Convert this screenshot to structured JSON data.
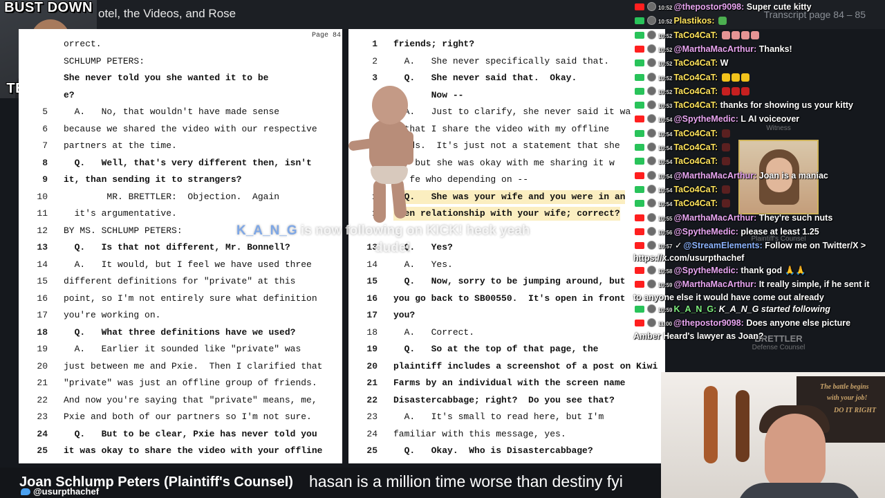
{
  "header": {
    "title": "otel, the Videos, and Rose",
    "transcript_pages": "Transcript page 84 – 85"
  },
  "logo": {
    "top": "BUST DOWN",
    "bottom": "TESTIMONY"
  },
  "left_page": {
    "label": "Page 84",
    "lines": [
      {
        "n": "",
        "t": "orrect.",
        "bold": false
      },
      {
        "n": "",
        "t": "SCHLUMP PETERS:",
        "bold": false
      },
      {
        "n": "",
        "t": "She never told you she wanted it to be",
        "bold": true
      },
      {
        "n": "",
        "t": "e?",
        "bold": true
      },
      {
        "n": "5",
        "t": "  A.   No, that wouldn't have made sense",
        "bold": false
      },
      {
        "n": "6",
        "t": "because we shared the video with our respective",
        "bold": false
      },
      {
        "n": "7",
        "t": "partners at the time.",
        "bold": false
      },
      {
        "n": "8",
        "t": "  Q.   Well, that's very different then, isn't",
        "bold": true
      },
      {
        "n": "9",
        "t": "it, than sending it to strangers?",
        "bold": true
      },
      {
        "n": "10",
        "t": "        MR. BRETTLER:  Objection.  Again",
        "bold": false
      },
      {
        "n": "11",
        "t": "  it's argumentative.",
        "bold": false
      },
      {
        "n": "12",
        "t": "BY MS. SCHLUMP PETERS:",
        "bold": false
      },
      {
        "n": "13",
        "t": "  Q.   Is that not different, Mr. Bonnell?",
        "bold": true
      },
      {
        "n": "14",
        "t": "  A.   It would, but I feel we have used three",
        "bold": false
      },
      {
        "n": "15",
        "t": "different definitions for \"private\" at this",
        "bold": false
      },
      {
        "n": "16",
        "t": "point, so I'm not entirely sure what definition",
        "bold": false
      },
      {
        "n": "17",
        "t": "you're working on.",
        "bold": false
      },
      {
        "n": "18",
        "t": "  Q.   What three definitions have we used?",
        "bold": true
      },
      {
        "n": "19",
        "t": "  A.   Earlier it sounded like \"private\" was",
        "bold": false
      },
      {
        "n": "20",
        "t": "just between me and Pxie.  Then I clarified that",
        "bold": false
      },
      {
        "n": "21",
        "t": "\"private\" was just an offline group of friends.",
        "bold": false
      },
      {
        "n": "22",
        "t": "And now you're saying that \"private\" means, me,",
        "bold": false
      },
      {
        "n": "23",
        "t": "Pxie and both of our partners so I'm not sure.",
        "bold": false
      },
      {
        "n": "24",
        "t": "  Q.   But to be clear, Pxie has never told you",
        "bold": true
      },
      {
        "n": "25",
        "t": "it was okay to share the video with your offline",
        "bold": true
      }
    ]
  },
  "right_page": {
    "lines": [
      {
        "n": "1",
        "t": "friends; right?",
        "bold": true,
        "hl": false
      },
      {
        "n": "2",
        "t": "  A.   She never specifically said that.",
        "bold": false,
        "hl": false
      },
      {
        "n": "3",
        "t": "  Q.   She never said that.  Okay.",
        "bold": true,
        "hl": false
      },
      {
        "n": "",
        "t": "       Now --",
        "bold": true,
        "hl": false
      },
      {
        "n": "",
        "t": "  A.   Just to clarify, she never said it wa",
        "bold": false,
        "hl": false
      },
      {
        "n": "",
        "t": "  that I share the video with my offline",
        "bold": false,
        "hl": false
      },
      {
        "n": "",
        "t": "  nds.  It's just not a statement that she",
        "bold": false,
        "hl": false
      },
      {
        "n": "",
        "t": "  , but she was okay with me sharing it w",
        "bold": false,
        "hl": false
      },
      {
        "n": "",
        "t": "   fe who depending on --",
        "bold": false,
        "hl": false
      },
      {
        "n": "1",
        "t": "  Q.   She was your wife and you were in an",
        "bold": true,
        "hl": true
      },
      {
        "n": "1",
        "t": "  en relationship with your wife; correct?",
        "bold": true,
        "hl": true
      },
      {
        "n": "",
        "t": "",
        "bold": false,
        "hl": false
      },
      {
        "n": "13",
        "t": "  Q.   Yes?",
        "bold": true,
        "hl": false
      },
      {
        "n": "14",
        "t": "  A.   Yes.",
        "bold": false,
        "hl": false
      },
      {
        "n": "15",
        "t": "  Q.   Now, sorry to be jumping around, but",
        "bold": true,
        "hl": false
      },
      {
        "n": "16",
        "t": "you go back to SB00550.  It's open in front",
        "bold": true,
        "hl": false
      },
      {
        "n": "17",
        "t": "you?",
        "bold": true,
        "hl": false
      },
      {
        "n": "18",
        "t": "  A.   Correct.",
        "bold": false,
        "hl": false
      },
      {
        "n": "19",
        "t": "  Q.   So at the top of that page, the",
        "bold": true,
        "hl": false
      },
      {
        "n": "20",
        "t": "plaintiff includes a screenshot of a post on Kiwi",
        "bold": true,
        "hl": false
      },
      {
        "n": "21",
        "t": "Farms by an individual with the screen name",
        "bold": true,
        "hl": false
      },
      {
        "n": "22",
        "t": "Disastercabbage; right?  Do you see that?",
        "bold": true,
        "hl": false
      },
      {
        "n": "23",
        "t": "  A.   It's small to read here, but I'm",
        "bold": false,
        "hl": false
      },
      {
        "n": "24",
        "t": "familiar with this message, yes.",
        "bold": false,
        "hl": false
      },
      {
        "n": "25",
        "t": "  Q.   Okay.  Who is Disastercabbage?",
        "bold": true,
        "hl": false
      }
    ]
  },
  "follow_alert": {
    "name": "K_A_N_G",
    "text": " is now following on KICK! heck yeah",
    "line2": "dude!"
  },
  "side_panels": {
    "witness_label": "Witness",
    "counsel_name": "BRETTLER",
    "counsel_role": "Defense Counsel",
    "plaintiff_counsel_role": "Plaintiff's Counsel"
  },
  "chat": [
    {
      "p": "yt",
      "time": "10:52",
      "user": "@thepostor9098:",
      "color": "#e9a6f2",
      "msg": "Super cute kitty"
    },
    {
      "p": "kk",
      "time": "10:52",
      "user": "Plastikos:",
      "color": "#ffe45c",
      "msg": "",
      "emoji": [
        "#4caf50"
      ]
    },
    {
      "p": "kk",
      "time": "10:52",
      "user": "TaCo4CaT:",
      "color": "#ffe45c",
      "msg": "",
      "emoji": [
        "#e59494",
        "#e59494",
        "#e59494",
        "#e59494"
      ]
    },
    {
      "p": "yt",
      "time": "10:52",
      "user": "@MarthaMacArthur:",
      "color": "#e9a6f2",
      "msg": "Thanks!"
    },
    {
      "p": "kk",
      "time": "10:52",
      "user": "TaCo4CaT:",
      "color": "#ffe45c",
      "msg": "W"
    },
    {
      "p": "kk",
      "time": "10:52",
      "user": "TaCo4CaT:",
      "color": "#ffe45c",
      "msg": "",
      "emoji": [
        "#f2c31b",
        "#f2c31b",
        "#f2c31b"
      ]
    },
    {
      "p": "kk",
      "time": "10:52",
      "user": "TaCo4CaT:",
      "color": "#ffe45c",
      "msg": "",
      "emoji": [
        "#c62020",
        "#c62020",
        "#c62020"
      ]
    },
    {
      "p": "kk",
      "time": "10:53",
      "user": "TaCo4CaT:",
      "color": "#ffe45c",
      "msg": "thanks for showing us your kitty"
    },
    {
      "p": "yt",
      "time": "10:54",
      "user": "@SpytheMedic:",
      "color": "#e9a6f2",
      "msg": "L AI voiceover"
    },
    {
      "p": "kk",
      "time": "10:54",
      "user": "TaCo4CaT:",
      "color": "#ffe45c",
      "msg": "",
      "emoji": [
        "#5a2020"
      ]
    },
    {
      "p": "kk",
      "time": "10:54",
      "user": "TaCo4CaT:",
      "color": "#ffe45c",
      "msg": "",
      "emoji": [
        "#5a2020"
      ]
    },
    {
      "p": "kk",
      "time": "10:54",
      "user": "TaCo4CaT:",
      "color": "#ffe45c",
      "msg": "",
      "emoji": [
        "#5a2020"
      ]
    },
    {
      "p": "yt",
      "time": "10:54",
      "user": "@MarthaMacArthur:",
      "color": "#e9a6f2",
      "msg": "Joan is a maniac"
    },
    {
      "p": "kk",
      "time": "10:54",
      "user": "TaCo4CaT:",
      "color": "#ffe45c",
      "msg": "",
      "emoji": [
        "#5a2020"
      ]
    },
    {
      "p": "kk",
      "time": "10:54",
      "user": "TaCo4CaT:",
      "color": "#ffe45c",
      "msg": "",
      "emoji": [
        "#5a2020"
      ]
    },
    {
      "p": "yt",
      "time": "10:55",
      "user": "@MarthaMacArthur:",
      "color": "#e9a6f2",
      "msg": "They're such nuts"
    },
    {
      "p": "yt",
      "time": "10:56",
      "user": "@SpytheMedic:",
      "color": "#e9a6f2",
      "msg": "please at least 1.25"
    },
    {
      "p": "yt",
      "time": "10:57",
      "user": "@StreamElements:",
      "color": "#8cb4ff",
      "msg": "Follow me on Twitter/X >",
      "check": true
    },
    {
      "p": "yt",
      "time": "10:58",
      "user": "@SpytheMedic:",
      "color": "#e9a6f2",
      "msg": "thank god 🙏🙏"
    },
    {
      "p": "yt",
      "time": "10:59",
      "user": "@MarthaMacArthur:",
      "color": "#e9a6f2",
      "msg": "It really simple, if he sent it"
    },
    {
      "p": "kk",
      "time": "10:59",
      "user": "K_A_N_G:",
      "color": "#7ef07e",
      "msg": "K_A_N_G started following",
      "italic": true
    },
    {
      "p": "yt",
      "time": "11:00",
      "user": "@thepostor9098:",
      "color": "#e9a6f2",
      "msg": "Does anyone else picture"
    }
  ],
  "chat_wraps": {
    "se_url": "https://x.com/usurpthachef",
    "martha_cont": "to anyone else it would have come out already",
    "thepostor_cont": "Amber Heard's lawyer as Joan?"
  },
  "lower_third": {
    "speaker": "Joan Schlump Peters (Plaintiff's Counsel)",
    "handle": "@usurpthachef",
    "caption": "hasan is a million time worse than destiny fyi"
  },
  "webcam_poster": {
    "line1": "The battle begins",
    "line2": "with your job!",
    "line3": "DO IT RIGHT"
  },
  "colors": {
    "youtube": "#ff1f1f",
    "kick": "#29c35a",
    "highlight": "#fbeec0",
    "twitter": "#4aa0ef"
  }
}
